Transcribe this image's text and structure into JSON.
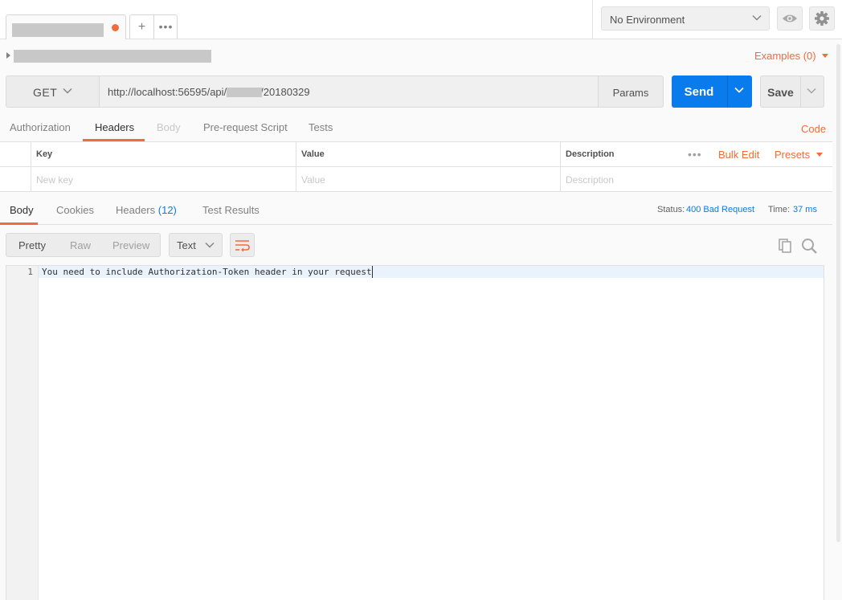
{
  "environment": {
    "selected": "No Environment"
  },
  "request": {
    "examples_label": "Examples (0)",
    "method": "GET",
    "url_prefix": "http://localhost:56595/api/",
    "url_suffix": "/20180329",
    "params_label": "Params",
    "send_label": "Send",
    "save_label": "Save"
  },
  "request_tabs": {
    "items": [
      "Authorization",
      "Headers",
      "Body",
      "Pre-request Script",
      "Tests"
    ],
    "active": "Headers",
    "code_label": "Code"
  },
  "headers_table": {
    "columns": [
      "Key",
      "Value",
      "Description"
    ],
    "placeholders": [
      "New key",
      "Value",
      "Description"
    ],
    "bulk_edit_label": "Bulk Edit",
    "presets_label": "Presets"
  },
  "response": {
    "tabs": [
      "Body",
      "Cookies",
      "Headers",
      "Test Results"
    ],
    "headers_count": "(12)",
    "active_tab": "Body",
    "status_label": "Status:",
    "status_value": "400 Bad Request",
    "time_label": "Time:",
    "time_value": "37 ms",
    "view_modes": [
      "Pretty",
      "Raw",
      "Preview"
    ],
    "active_view": "Raw",
    "format": "Text",
    "lines": [
      {
        "number": "1",
        "text": "You need to include Authorization-Token header in your request"
      }
    ]
  },
  "colors": {
    "accent": "#f26b3a",
    "send": "#097bed",
    "link": "#097bed"
  },
  "icons": [
    "plus-icon",
    "more-icon",
    "chevron-down-icon",
    "eye-icon",
    "gear-icon",
    "wrap-lines-icon",
    "copy-icon",
    "search-icon"
  ]
}
